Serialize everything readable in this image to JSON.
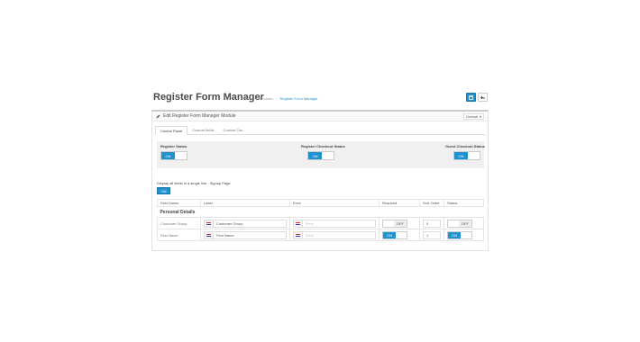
{
  "header": {
    "title": "Register Form Manager",
    "breadcrumb": [
      "Home",
      "Modules",
      "Register Form Manager"
    ]
  },
  "panel": {
    "title": "Edit Register Form Manager Module",
    "store_select": "Default",
    "tabs": [
      "Control Panel",
      "Custom fields",
      "Custom Css"
    ],
    "active_tab": "Control Panel"
  },
  "statuses": [
    {
      "label": "Register Status",
      "value": "ON"
    },
    {
      "label": "Register Checkout Status",
      "value": "ON"
    },
    {
      "label": "Guest Checkout Status",
      "value": "ON"
    }
  ],
  "single_line": {
    "label": "Display all fields in a single line - Signup Page",
    "value": "ON"
  },
  "table": {
    "headers": [
      "Field Name",
      "Label",
      "Error",
      "Required",
      "Sort Order",
      "Status"
    ],
    "group": "Personal Details",
    "rows": [
      {
        "field": "Customer Group",
        "label": "Customer Group",
        "error_placeholder": "Error",
        "required": "OFF",
        "sort": "0",
        "status": "OFF"
      },
      {
        "field": "First Name",
        "label": "First Name",
        "error_placeholder": "Error",
        "required": "ON",
        "sort": "1",
        "status": "ON"
      }
    ]
  },
  "colors": {
    "accent": "#1e91cf"
  }
}
